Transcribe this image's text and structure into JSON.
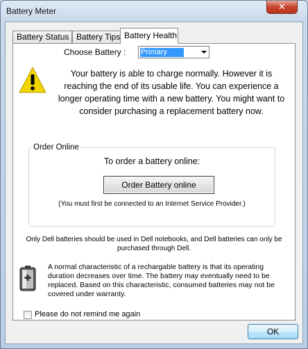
{
  "window": {
    "title": "Battery Meter",
    "close_glyph": "✕"
  },
  "tabs": [
    {
      "label": "Battery Status",
      "active": false
    },
    {
      "label": "Battery Tips",
      "active": false
    },
    {
      "label": "Battery Health",
      "active": true
    }
  ],
  "health": {
    "choose_label": "Choose Battery :",
    "battery_selected": "Primary",
    "warning_icon": "warning-icon",
    "warning_message": "Your battery is able to charge normally. However it is reaching the end of its usable life. You can experience a longer operating time with a new battery. You might want to consider purchasing a replacement battery now.",
    "order_group_label": "Order Online",
    "order_title": "To order a battery online:",
    "order_button": "Order Battery online",
    "order_note": "(You must first be connected to an Internet Service Provider.)",
    "dell_note": "Only Dell batteries should be used in Dell notebooks, and Dell batteries can only be purchased through Dell.",
    "battery_icon": "battery-icon",
    "battery_note": "A normal characteristic of a rechargable battery is that its operating duration decreases over time.  The battery may eventually need to be replaced.  Based on this characteristic, consumed batteries may not be covered under warranty.",
    "remind_label": "Please do not remind me again",
    "remind_checked": false
  },
  "footer": {
    "ok_label": "OK"
  },
  "colors": {
    "selection": "#3399ff",
    "warning_yellow": "#f2d500",
    "close_red": "#c7432c"
  }
}
